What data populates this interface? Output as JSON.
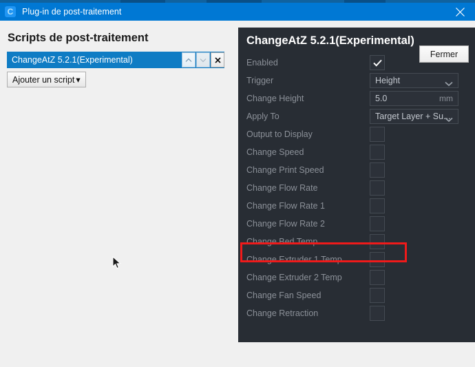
{
  "window": {
    "title": "Plug-in de post-traitement",
    "app_icon": "cura-logo-icon",
    "app_icon_letter": "C",
    "close_icon": "close-icon"
  },
  "colors": {
    "titlebar": "#0078d4",
    "selection": "#0f7cc4",
    "panel_bg": "#282d34",
    "highlight": "#f01a1a",
    "label_text": "#8c9199",
    "value_text": "#c3c8cf"
  },
  "left": {
    "heading": "Scripts de post-traitement",
    "scripts": [
      {
        "label": "ChangeAtZ 5.2.1(Experimental)",
        "selected": true
      }
    ],
    "list_buttons": [
      {
        "name": "move-up-button",
        "icon": "chevron-up-icon"
      },
      {
        "name": "move-down-button",
        "icon": "chevron-down-icon"
      },
      {
        "name": "remove-script-button",
        "icon": "close-icon"
      }
    ],
    "add_script_label": "Ajouter un script",
    "add_script_caret": "▾"
  },
  "panel": {
    "title": "ChangeAtZ 5.2.1(Experimental)",
    "settings": [
      {
        "label": "Enabled",
        "control": "checkbox",
        "checked": true
      },
      {
        "label": "Trigger",
        "control": "combo",
        "value": "Height"
      },
      {
        "label": "Change Height",
        "control": "text",
        "value": "5.0",
        "unit": "mm"
      },
      {
        "label": "Apply To",
        "control": "combo",
        "value": "Target Layer + Su..."
      },
      {
        "label": "Output to Display",
        "control": "checkbox",
        "checked": false
      },
      {
        "label": "Change Speed",
        "control": "checkbox",
        "checked": false
      },
      {
        "label": "Change Print Speed",
        "control": "checkbox",
        "checked": false
      },
      {
        "label": "Change Flow Rate",
        "control": "checkbox",
        "checked": false
      },
      {
        "label": "Change Flow Rate 1",
        "control": "checkbox",
        "checked": false
      },
      {
        "label": "Change Flow Rate 2",
        "control": "checkbox",
        "checked": false
      },
      {
        "label": "Change Bed Temp",
        "control": "checkbox",
        "checked": false,
        "highlighted": true
      },
      {
        "label": "Change Extruder 1 Temp",
        "control": "checkbox",
        "checked": false
      },
      {
        "label": "Change Extruder 2 Temp",
        "control": "checkbox",
        "checked": false
      },
      {
        "label": "Change Fan Speed",
        "control": "checkbox",
        "checked": false
      },
      {
        "label": "Change Retraction",
        "control": "checkbox",
        "checked": false
      }
    ]
  },
  "footer": {
    "close_label": "Fermer"
  }
}
